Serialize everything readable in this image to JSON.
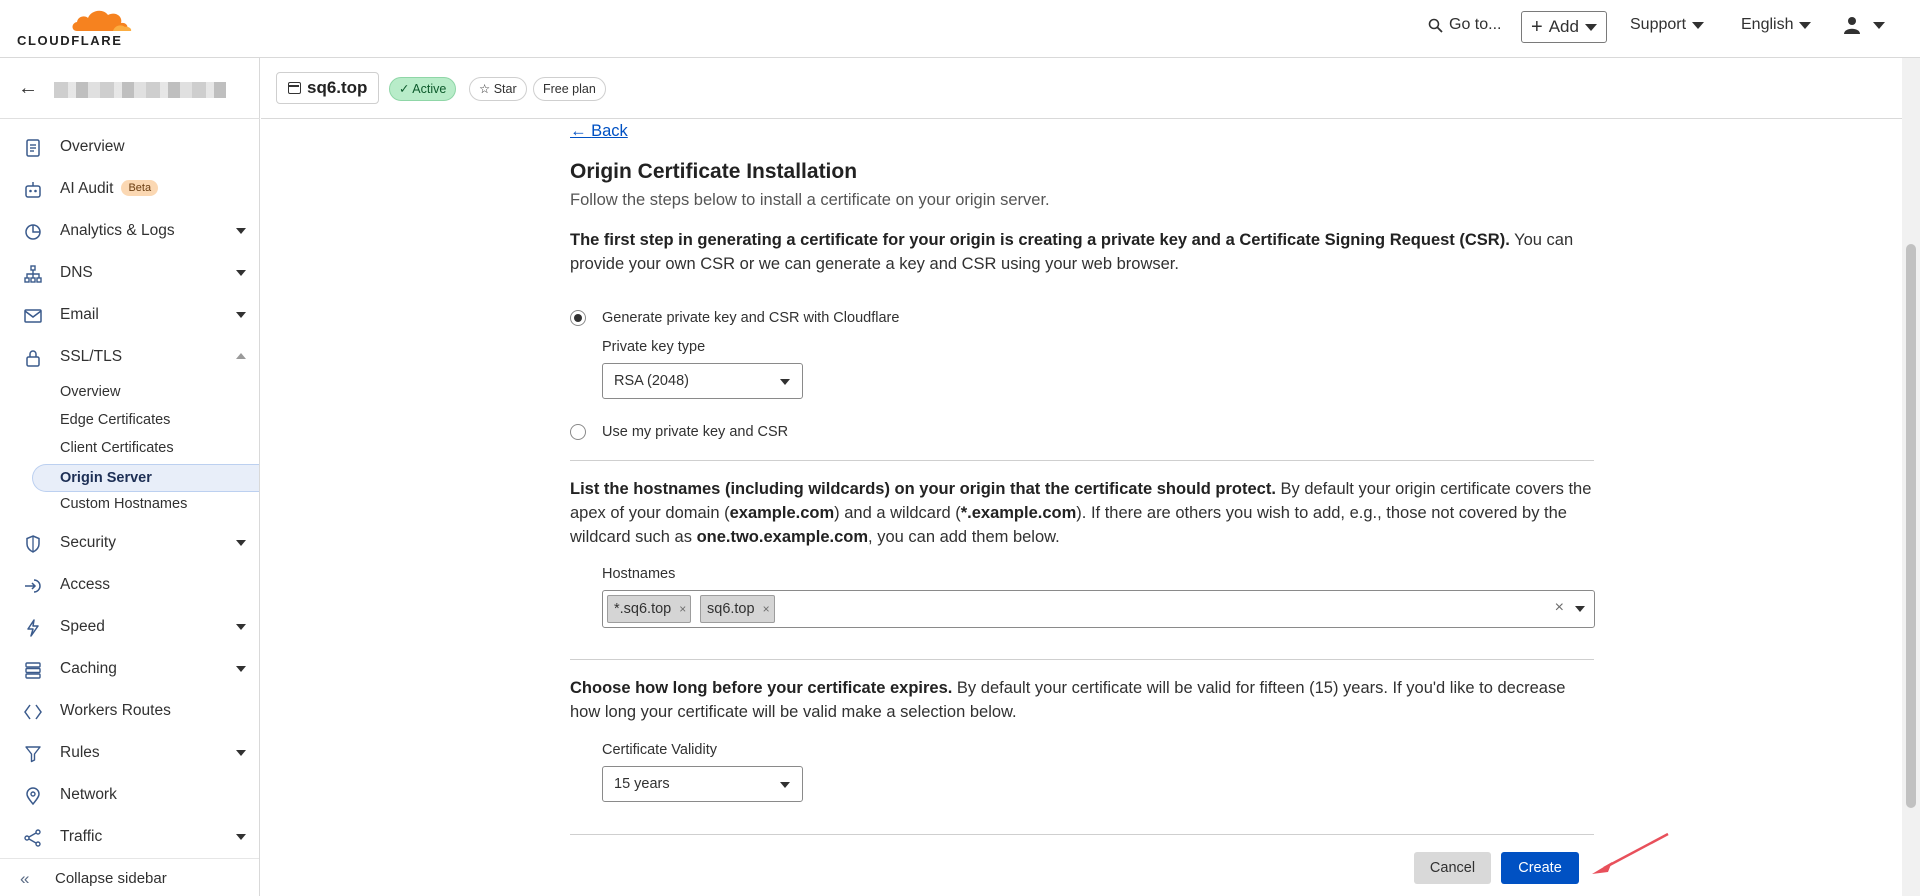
{
  "topnav": {
    "logo_text": "CLOUDFLARE",
    "goto_label": "Go to...",
    "add_label": "Add",
    "support_label": "Support",
    "language_label": "English"
  },
  "sidebar": {
    "items": [
      {
        "label": "Overview",
        "icon": "document-icon"
      },
      {
        "label": "AI Audit",
        "icon": "robot-icon",
        "badge": "Beta"
      },
      {
        "label": "Analytics & Logs",
        "icon": "pie-chart-icon"
      },
      {
        "label": "DNS",
        "icon": "network-tree-icon"
      },
      {
        "label": "Email",
        "icon": "envelope-icon"
      },
      {
        "label": "SSL/TLS",
        "icon": "lock-icon"
      },
      {
        "label": "Security",
        "icon": "shield-icon"
      },
      {
        "label": "Access",
        "icon": "access-arrow-icon"
      },
      {
        "label": "Speed",
        "icon": "lightning-icon"
      },
      {
        "label": "Caching",
        "icon": "server-stack-icon"
      },
      {
        "label": "Workers Routes",
        "icon": "diamond-code-icon"
      },
      {
        "label": "Rules",
        "icon": "funnel-icon"
      },
      {
        "label": "Network",
        "icon": "location-pin-icon"
      },
      {
        "label": "Traffic",
        "icon": "share-nodes-icon"
      }
    ],
    "ssl_sub_items": [
      "Overview",
      "Edge Certificates",
      "Client Certificates",
      "Origin Server",
      "Custom Hostnames"
    ],
    "collapse_label": "Collapse sidebar"
  },
  "zone": {
    "name": "sq6.top",
    "status": "Active",
    "star_label": "Star",
    "plan": "Free plan"
  },
  "main": {
    "back_label": "Back",
    "title": "Origin Certificate Installation",
    "subtitle": "Follow the steps below to install a certificate on your origin server.",
    "step1_bold": "The first step in generating a certificate for your origin is creating a private key and a Certificate Signing Request (CSR).",
    "step1_rest": " You can provide your own CSR or we can generate a key and CSR using your web browser.",
    "radio_generate": "Generate private key and CSR with Cloudflare",
    "private_key_type_label": "Private key type",
    "private_key_type_value": "RSA (2048)",
    "radio_own": "Use my private key and CSR",
    "hostnames_bold": "List the hostnames (including wildcards) on your origin that the certificate should protect.",
    "hostnames_t1": " By default your origin certificate covers the apex of your domain (",
    "hostnames_b1": "example.com",
    "hostnames_t2": ") and a wildcard (",
    "hostnames_b2": "*.example.com",
    "hostnames_t3": "). If there are others you wish to add, e.g., those not covered by the wildcard such as ",
    "hostnames_b3": "one.two.example.com",
    "hostnames_t4": ", you can add them below.",
    "hostnames_label": "Hostnames",
    "hostname_tags": [
      "*.sq6.top",
      "sq6.top"
    ],
    "validity_bold": "Choose how long before your certificate expires.",
    "validity_rest": " By default your certificate will be valid for fifteen (15) years. If you'd like to decrease how long your certificate will be valid make a selection below.",
    "validity_label": "Certificate Validity",
    "validity_value": "15 years",
    "cancel_label": "Cancel",
    "create_label": "Create"
  },
  "colors": {
    "accent": "#0051c3",
    "brand_orange": "#f6821f",
    "annotation_arrow": "#e8505b",
    "active_green": "#b8ecc9"
  }
}
